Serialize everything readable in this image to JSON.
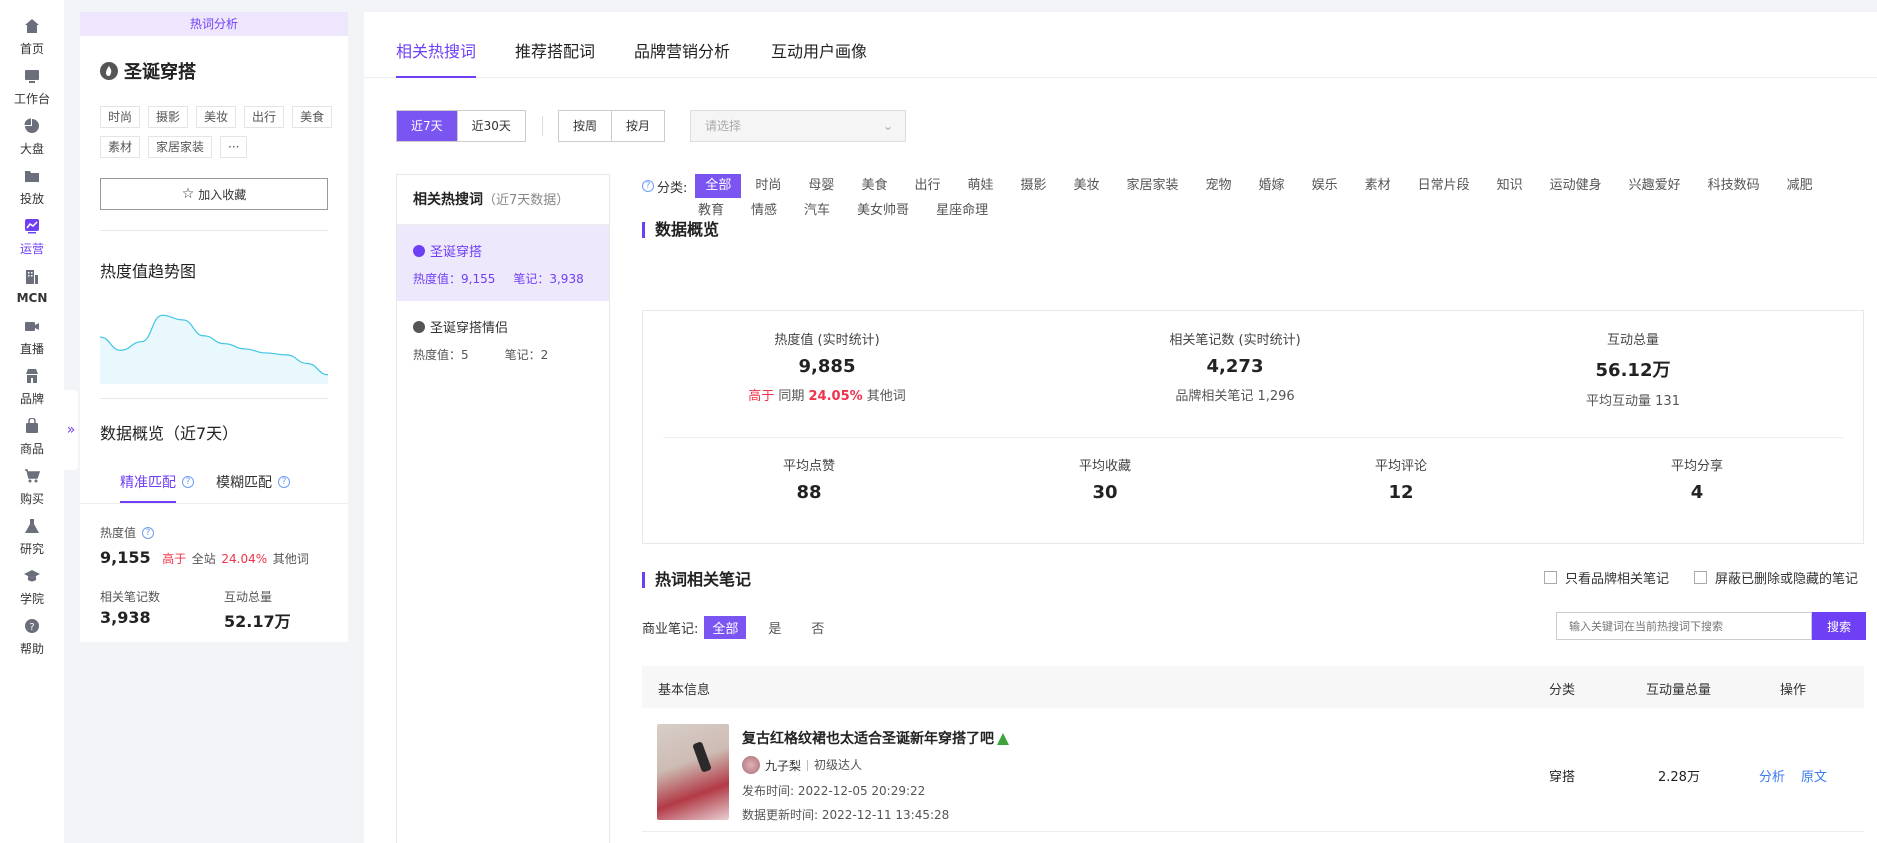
{
  "nav": {
    "items": [
      {
        "label": "首页",
        "icon": "home-icon"
      },
      {
        "label": "工作台",
        "icon": "workbench-icon"
      },
      {
        "label": "大盘",
        "icon": "pie-chart-icon"
      },
      {
        "label": "投放",
        "icon": "folder-icon"
      },
      {
        "label": "运营",
        "icon": "trend-chart-icon"
      },
      {
        "label": "MCN",
        "icon": "building-icon"
      },
      {
        "label": "直播",
        "icon": "video-camera-icon"
      },
      {
        "label": "品牌",
        "icon": "store-icon"
      },
      {
        "label": "商品",
        "icon": "bag-icon"
      },
      {
        "label": "购买",
        "icon": "cart-icon"
      },
      {
        "label": "研究",
        "icon": "flask-icon"
      },
      {
        "label": "学院",
        "icon": "graduation-cap-icon"
      },
      {
        "label": "帮助",
        "icon": "help-icon"
      }
    ],
    "active": "运营",
    "expand_glyph": "»"
  },
  "keyword_panel": {
    "header": "热词分析",
    "keyword": "圣诞穿搭",
    "tags": [
      "时尚",
      "摄影",
      "美妆",
      "出行",
      "美食",
      "素材",
      "家居家装",
      "···"
    ],
    "collect_label": "加入收藏",
    "trend_title": "热度值趋势图",
    "trend_values": [
      0.62,
      0.42,
      0.55,
      0.95,
      0.88,
      0.64,
      0.52,
      0.44,
      0.38,
      0.35,
      0.22,
      0.05
    ],
    "overview_title": "数据概览（近7天）",
    "tabs": [
      "精准匹配",
      "模糊匹配"
    ],
    "heat_label": "热度值",
    "heat_value": "9,155",
    "heat_cmp_prefix": "高于",
    "heat_cmp_scope": "全站",
    "heat_cmp_pct": "24.04%",
    "heat_cmp_suffix": "其他词",
    "notes_label": "相关笔记数",
    "notes_value": "3,938",
    "interact_label": "互动总量",
    "interact_value": "52.17万"
  },
  "main": {
    "top_tabs": [
      "相关热搜词",
      "推荐搭配词",
      "品牌营销分析",
      "互动用户画像"
    ],
    "range_options": [
      "近7天",
      "近30天"
    ],
    "period_options": [
      "按周",
      "按月"
    ],
    "select_placeholder": "请选择",
    "kwlist": {
      "title": "相关热搜词",
      "subtitle": "（近7天数据）",
      "items": [
        {
          "name": "圣诞穿搭",
          "heat": "热度值：9,155",
          "notes": "笔记：3,938"
        },
        {
          "name": "圣诞穿搭情侣",
          "heat": "热度值：5",
          "notes": "笔记：2"
        }
      ]
    },
    "categories_label": "分类:",
    "categories_row1": [
      "全部",
      "时尚",
      "母婴",
      "美食",
      "出行",
      "萌娃",
      "摄影",
      "美妆",
      "家居家装",
      "宠物",
      "婚嫁",
      "娱乐",
      "素材",
      "日常片段",
      "知识",
      "运动健身",
      "兴趣爱好",
      "科技数码",
      "减肥"
    ],
    "categories_row2": [
      "教育",
      "情感",
      "汽车",
      "美女帅哥",
      "星座命理"
    ],
    "overview_title": "数据概览",
    "overview": {
      "heat_label": "热度值 (实时统计)",
      "heat_value": "9,885",
      "heat_cmp_prefix": "高于",
      "heat_cmp_scope": "同期",
      "heat_cmp_pct": "24.05%",
      "heat_cmp_suffix": "其他词",
      "notes_label": "相关笔记数 (实时统计)",
      "notes_value": "4,273",
      "brand_notes": "品牌相关笔记 1,296",
      "interact_label": "互动总量",
      "interact_value": "56.12万",
      "avg_interact": "平均互动量 131",
      "avg_like_label": "平均点赞",
      "avg_like_value": "88",
      "avg_collect_label": "平均收藏",
      "avg_collect_value": "30",
      "avg_comment_label": "平均评论",
      "avg_comment_value": "12",
      "avg_share_label": "平均分享",
      "avg_share_value": "4"
    },
    "notes_title": "热词相关笔记",
    "filter_brand": "只看品牌相关笔记",
    "filter_hidden": "屏蔽已删除或隐藏的笔记",
    "biz_label": "商业笔记:",
    "biz_options": [
      "全部",
      "是",
      "否"
    ],
    "search_placeholder": "输入关键词在当前热搜词下搜索",
    "search_btn": "搜索",
    "table_headers": [
      "基本信息",
      "分类",
      "互动量总量",
      "操作"
    ],
    "row": {
      "title": "复古红格纹裙也太适合圣诞新年穿搭了吧",
      "author": "九子梨",
      "level": "初级达人",
      "publish": "发布时间:  2022-12-05 20:29:22",
      "update": "数据更新时间:   2022-12-11 13:45:28",
      "category": "穿搭",
      "interact": "2.28万",
      "action_analyze": "分析",
      "action_origin": "原文"
    }
  },
  "colors": {
    "accent": "#6f3ff5",
    "highlight": "#f0334b",
    "link": "#3c7bf2"
  }
}
